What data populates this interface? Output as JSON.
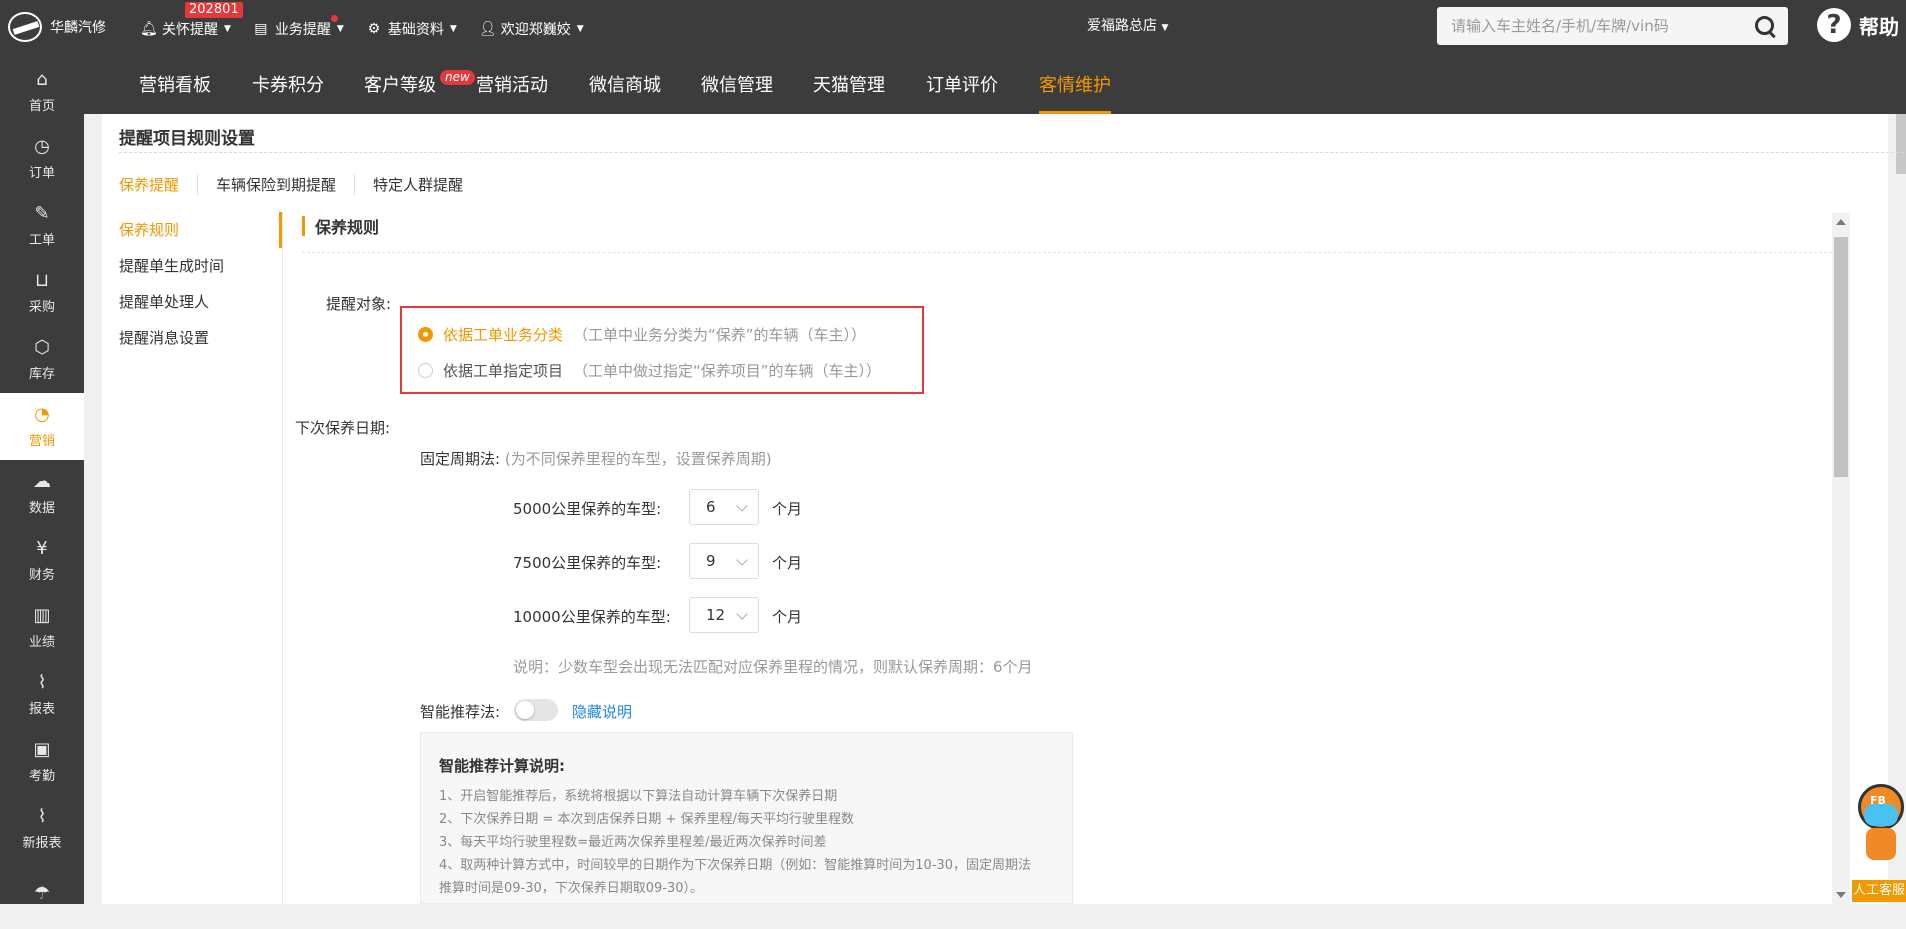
{
  "header": {
    "logo_text": "华麟汽修",
    "nav": [
      {
        "label": "关怀提醒",
        "badge": "202801",
        "icon": "bell-icon"
      },
      {
        "label": "业务提醒",
        "icon": "document-icon"
      },
      {
        "label": "基础资料",
        "icon": "gear-icon"
      },
      {
        "label": "欢迎郑巍姣",
        "icon": "user-icon"
      }
    ],
    "store": "爱福路总店",
    "search_placeholder": "请输入车主姓名/手机/车牌/vin码",
    "help_label": "帮助"
  },
  "sidebar": {
    "items": [
      {
        "label": "首页",
        "icon": "home-icon",
        "glyph": "⌂"
      },
      {
        "label": "订单",
        "icon": "clock-icon",
        "glyph": "◷"
      },
      {
        "label": "工单",
        "icon": "wrench-icon",
        "glyph": "✎"
      },
      {
        "label": "采购",
        "icon": "cart-icon",
        "glyph": "⊔"
      },
      {
        "label": "库存",
        "icon": "box-icon",
        "glyph": "⬡"
      },
      {
        "label": "营销",
        "icon": "pie-icon",
        "glyph": "◔",
        "active": true
      },
      {
        "label": "数据",
        "icon": "cloud-icon",
        "glyph": "☁"
      },
      {
        "label": "财务",
        "icon": "yen-icon",
        "glyph": "¥"
      },
      {
        "label": "业绩",
        "icon": "bar-chart-icon",
        "glyph": "▥"
      },
      {
        "label": "报表",
        "icon": "line-chart-icon",
        "glyph": "⌇"
      },
      {
        "label": "考勤",
        "icon": "calendar-check-icon",
        "glyph": "▣"
      },
      {
        "label": "新报表",
        "icon": "line-chart-icon",
        "glyph": "⌇"
      },
      {
        "label": "",
        "icon": "umbrella-icon",
        "glyph": "☂"
      }
    ]
  },
  "subnav": {
    "tabs": [
      "营销看板",
      "卡券积分",
      "客户等级",
      "营销活动",
      "微信商城",
      "微信管理",
      "天猫管理",
      "订单评价",
      "客情维护"
    ],
    "new_badge": "new",
    "active_index": 8
  },
  "page": {
    "title": "提醒项目规则设置",
    "rule_tabs": [
      "保养提醒",
      "车辆保险到期提醒",
      "特定人群提醒"
    ],
    "left_menu": [
      "保养规则",
      "提醒单生成时间",
      "提醒单处理人",
      "提醒消息设置"
    ],
    "section_title": "保养规则",
    "target_label": "提醒对象:",
    "radio": [
      {
        "label": "依据工单业务分类",
        "hint": "（工单中业务分类为“保养”的车辆（车主））",
        "checked": true
      },
      {
        "label": "依据工单指定项目",
        "hint": "（工单中做过指定“保养项目”的车辆（车主））",
        "checked": false
      }
    ],
    "next_date_label": "下次保养日期:",
    "fixed_label": "固定周期法:",
    "fixed_hint": "(为不同保养里程的车型，设置保养周期)",
    "cycles": [
      {
        "label": "5000公里保养的车型:",
        "value": "6",
        "unit": "个月"
      },
      {
        "label": "7500公里保养的车型:",
        "value": "9",
        "unit": "个月"
      },
      {
        "label": "10000公里保养的车型:",
        "value": "12",
        "unit": "个月"
      }
    ],
    "cycle_note": "说明：少数车型会出现无法匹配对应保养里程的情况，则默认保养周期：6个月",
    "smart_label": "智能推荐法:",
    "hide_link": "隐藏说明",
    "note_title": "智能推荐计算说明:",
    "note_lines": [
      "1、开启智能推荐后，系统将根据以下算法自动计算车辆下次保养日期",
      "2、下次保养日期 = 本次到店保养日期 + 保养里程/每天平均行驶里程数",
      "3、每天平均行驶里程数=最近两次保养里程差/最近两次保养时间差",
      "4、取两种计算方式中，时间较早的日期作为下次保养日期（例如：智能推算时间为10-30，固定周期法",
      "推算时间是09-30，下次保养日期取09-30）。"
    ]
  },
  "mascot": {
    "badge_text": "FB",
    "label": "人工客服"
  },
  "colors": {
    "accent": "#f39800",
    "dark": "#3c3c3c",
    "alert": "#e4393c",
    "link": "#1e88e5"
  }
}
